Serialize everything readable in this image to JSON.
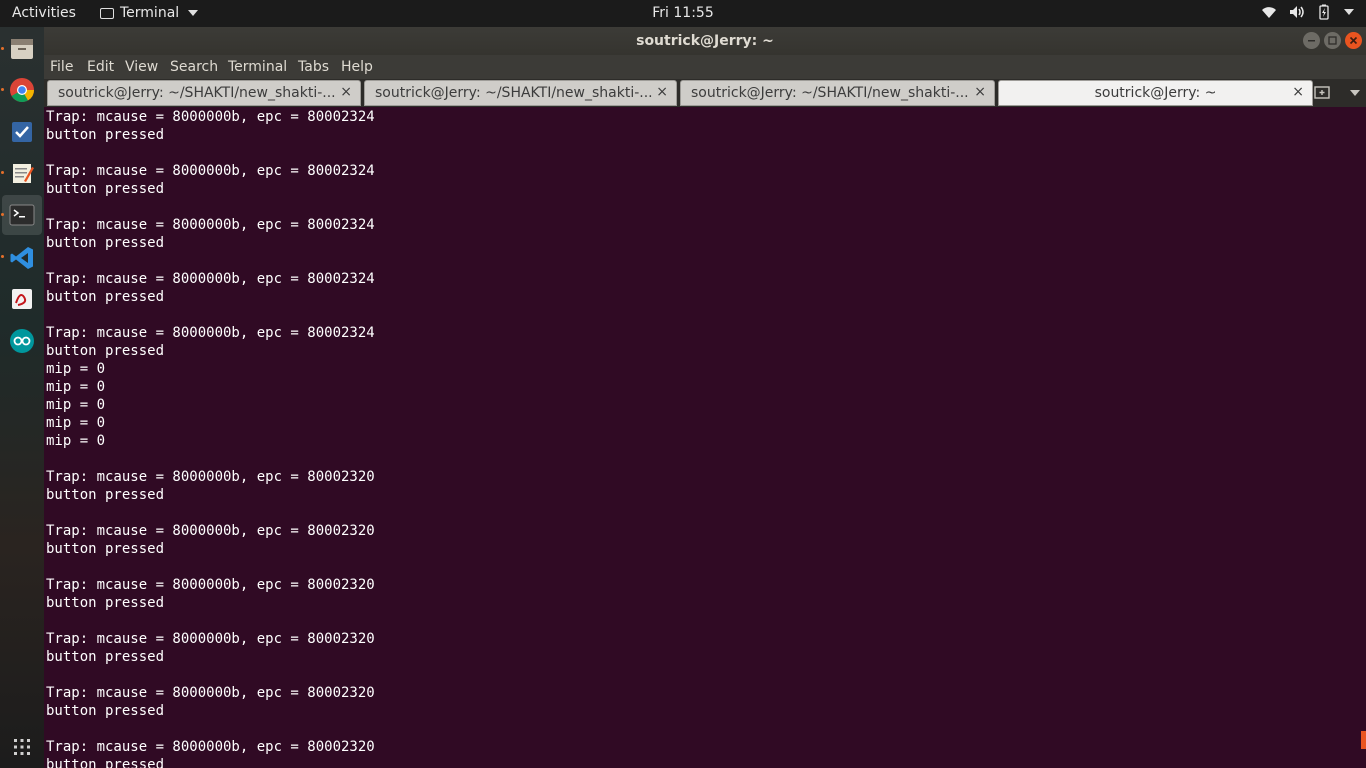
{
  "topbar": {
    "activities": "Activities",
    "app_name": "Terminal",
    "clock": "Fri 11:55"
  },
  "window": {
    "title": "soutrick@Jerry: ~"
  },
  "menu": [
    "File",
    "Edit",
    "View",
    "Search",
    "Terminal",
    "Tabs",
    "Help"
  ],
  "tabs": [
    {
      "label": "soutrick@Jerry: ~/SHAKTI/new_shakti-..."
    },
    {
      "label": "soutrick@Jerry: ~/SHAKTI/new_shakti-..."
    },
    {
      "label": "soutrick@Jerry: ~/SHAKTI/new_shakti-..."
    },
    {
      "label": "soutrick@Jerry: ~"
    }
  ],
  "tab_close_glyph": "×",
  "terminal": {
    "output": "Trap: mcause = 8000000b, epc = 80002324\nbutton pressed\n\nTrap: mcause = 8000000b, epc = 80002324\nbutton pressed\n\nTrap: mcause = 8000000b, epc = 80002324\nbutton pressed\n\nTrap: mcause = 8000000b, epc = 80002324\nbutton pressed\n\nTrap: mcause = 8000000b, epc = 80002324\nbutton pressed\nmip = 0\nmip = 0\nmip = 0\nmip = 0\nmip = 0\n\nTrap: mcause = 8000000b, epc = 80002320\nbutton pressed\n\nTrap: mcause = 8000000b, epc = 80002320\nbutton pressed\n\nTrap: mcause = 8000000b, epc = 80002320\nbutton pressed\n\nTrap: mcause = 8000000b, epc = 80002320\nbutton pressed\n\nTrap: mcause = 8000000b, epc = 80002320\nbutton pressed\n\nTrap: mcause = 8000000b, epc = 80002320\nbutton pressed"
  },
  "dock": [
    {
      "icon": "files-icon"
    },
    {
      "icon": "chrome-icon"
    },
    {
      "icon": "tasks-icon"
    },
    {
      "icon": "text-editor-icon"
    },
    {
      "icon": "terminal-icon"
    },
    {
      "icon": "vscode-icon"
    },
    {
      "icon": "document-viewer-icon"
    },
    {
      "icon": "arduino-icon"
    },
    {
      "icon": "show-applications-icon"
    }
  ],
  "colors": {
    "terminal_bg": "#300a24",
    "accent": "#e95420"
  }
}
